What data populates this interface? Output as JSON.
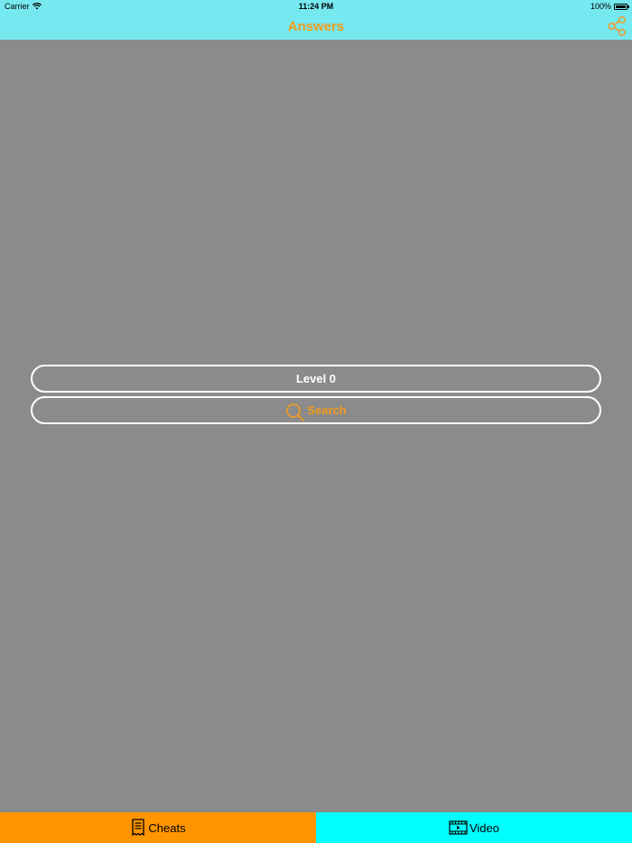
{
  "status_bar": {
    "carrier": "Carrier",
    "time": "11:24 PM",
    "battery": "100%"
  },
  "nav": {
    "title": "Answers",
    "share_icon": "share-icon"
  },
  "main": {
    "level_label": "Level 0",
    "search_label": "Search",
    "search_icon": "search-icon"
  },
  "tabs": [
    {
      "label": "Cheats",
      "icon": "receipt-icon"
    },
    {
      "label": "Video",
      "icon": "film-icon"
    }
  ],
  "colors": {
    "background": "#8b8b8b",
    "nav_bar": "#76e8ef",
    "accent": "#f29b1d",
    "tab_cheats": "#ff9500",
    "tab_video": "#00ffff"
  }
}
